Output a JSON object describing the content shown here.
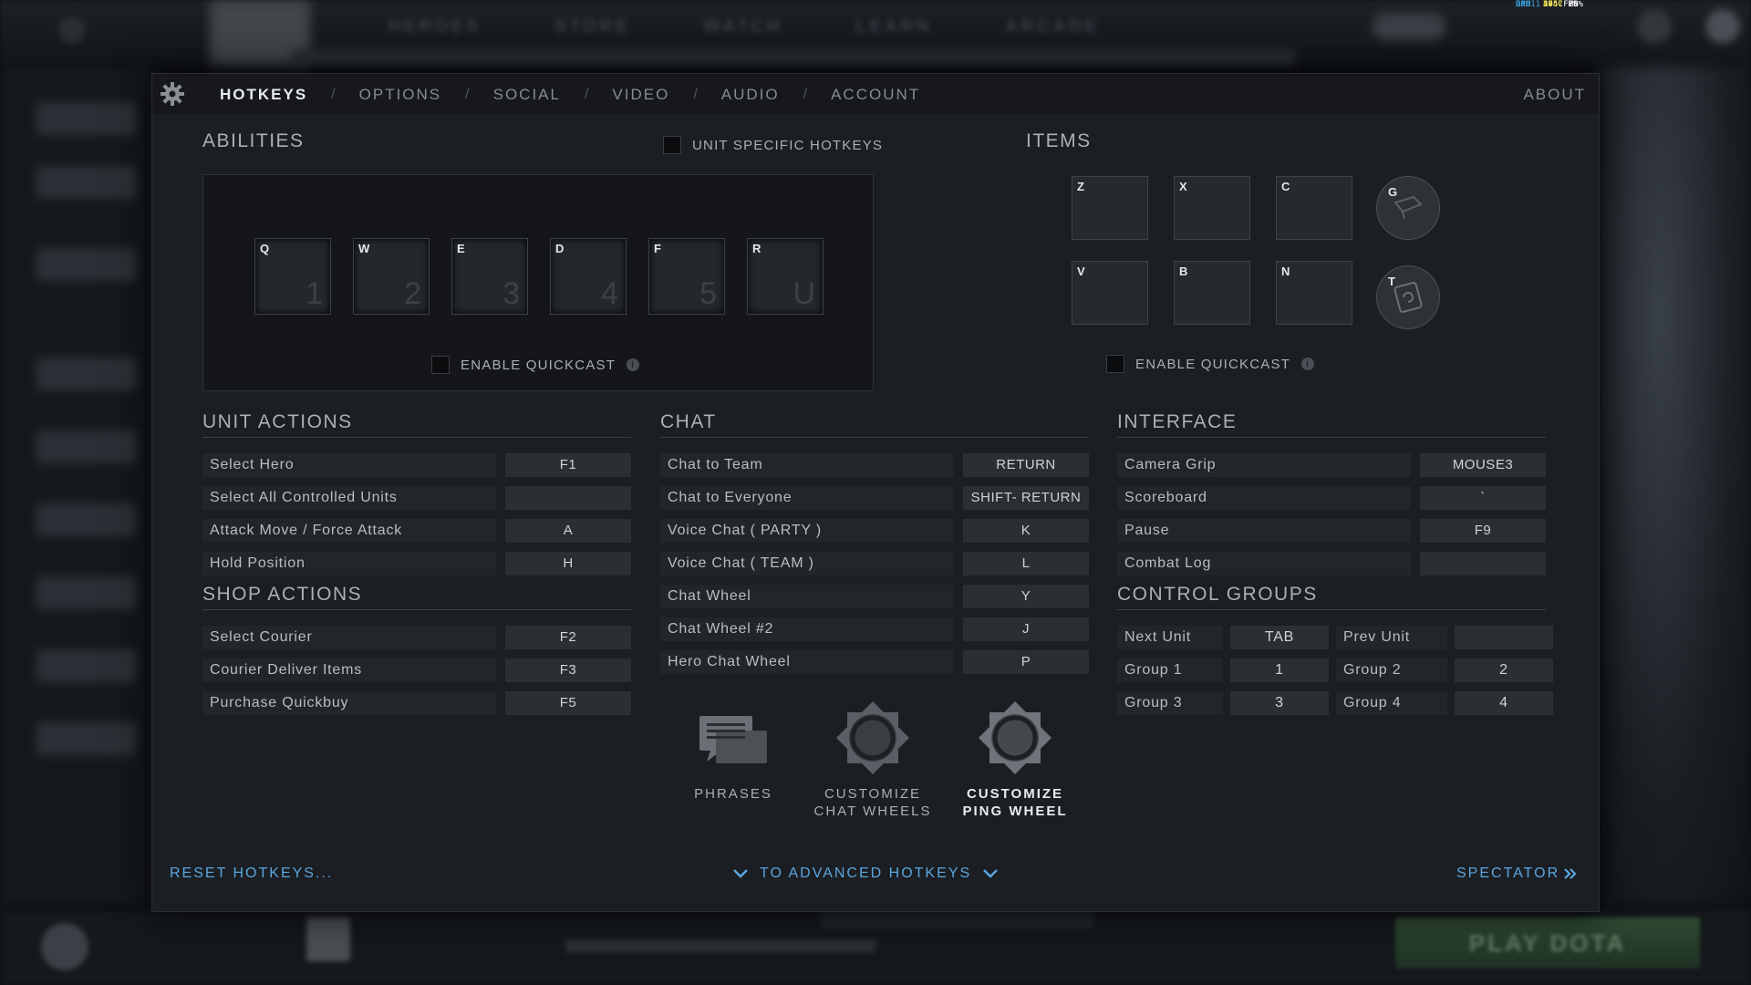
{
  "background": {
    "nav": [
      "HEROES",
      "STORE",
      "WATCH",
      "LEARN",
      "ARCADE"
    ],
    "play_button": "PLAY DOTA"
  },
  "perf_overlay": [
    {
      "k": "GPU",
      "v": "47°C",
      "w": "70%"
    },
    {
      "k": "CPU",
      "v": "50°C",
      "w": "2%"
    },
    {
      "k": "RAM",
      "v": "2957",
      "w": "MB"
    },
    {
      "k": "D3D11",
      "v": "144",
      "w": "FPS"
    }
  ],
  "tabs": [
    "HOTKEYS",
    "OPTIONS",
    "SOCIAL",
    "VIDEO",
    "AUDIO",
    "ACCOUNT"
  ],
  "active_tab": "HOTKEYS",
  "about": "ABOUT",
  "abilities": {
    "title": "ABILITIES",
    "unit_specific": "UNIT SPECIFIC HOTKEYS",
    "slots": [
      {
        "key": "Q",
        "num": "1"
      },
      {
        "key": "W",
        "num": "2"
      },
      {
        "key": "E",
        "num": "3"
      },
      {
        "key": "D",
        "num": "4"
      },
      {
        "key": "F",
        "num": "5"
      },
      {
        "key": "R",
        "num": "U"
      }
    ],
    "quickcast": "ENABLE QUICKCAST"
  },
  "items": {
    "title": "ITEMS",
    "slots": [
      "Z",
      "X",
      "C",
      "V",
      "B",
      "N"
    ],
    "round": [
      "G",
      "T"
    ],
    "quickcast": "ENABLE QUICKCAST"
  },
  "unit_actions": {
    "title": "UNIT ACTIONS",
    "rows": [
      {
        "label": "Select Hero",
        "key": "F1"
      },
      {
        "label": "Select All Controlled Units",
        "key": ""
      },
      {
        "label": "Attack Move / Force Attack",
        "key": "A"
      },
      {
        "label": "Hold Position",
        "key": "H"
      }
    ]
  },
  "shop_actions": {
    "title": "SHOP ACTIONS",
    "rows": [
      {
        "label": "Select Courier",
        "key": "F2"
      },
      {
        "label": "Courier Deliver Items",
        "key": "F3"
      },
      {
        "label": "Purchase Quickbuy",
        "key": "F5"
      }
    ]
  },
  "chat": {
    "title": "CHAT",
    "rows": [
      {
        "label": "Chat to Team",
        "key": "RETURN"
      },
      {
        "label": "Chat to Everyone",
        "key": "SHIFT- RETURN"
      },
      {
        "label": "Voice Chat ( PARTY )",
        "key": "K"
      },
      {
        "label": "Voice Chat ( TEAM )",
        "key": "L"
      },
      {
        "label": "Chat Wheel",
        "key": "Y"
      },
      {
        "label": "Chat Wheel #2",
        "key": "J"
      },
      {
        "label": "Hero Chat Wheel",
        "key": "P"
      }
    ],
    "buttons": [
      {
        "line1": "PHRASES",
        "line2": ""
      },
      {
        "line1": "CUSTOMIZE",
        "line2": "CHAT WHEELS"
      },
      {
        "line1": "CUSTOMIZE",
        "line2": "PING WHEEL"
      }
    ]
  },
  "interface": {
    "title": "INTERFACE",
    "rows": [
      {
        "label": "Camera Grip",
        "key": "MOUSE3"
      },
      {
        "label": "Scoreboard",
        "key": "`"
      },
      {
        "label": "Pause",
        "key": "F9"
      },
      {
        "label": "Combat Log",
        "key": ""
      }
    ]
  },
  "control_groups": {
    "title": "CONTROL GROUPS",
    "rows": [
      {
        "l1": "Next Unit",
        "k1": "TAB",
        "l2": "Prev Unit",
        "k2": ""
      },
      {
        "l1": "Group 1",
        "k1": "1",
        "l2": "Group 2",
        "k2": "2"
      },
      {
        "l1": "Group 3",
        "k1": "3",
        "l2": "Group 4",
        "k2": "4"
      }
    ]
  },
  "footer": {
    "reset": "RESET HOTKEYS...",
    "advanced": "TO ADVANCED HOTKEYS",
    "spectator": "SPECTATOR"
  },
  "accent_color": "#5aa6e0"
}
